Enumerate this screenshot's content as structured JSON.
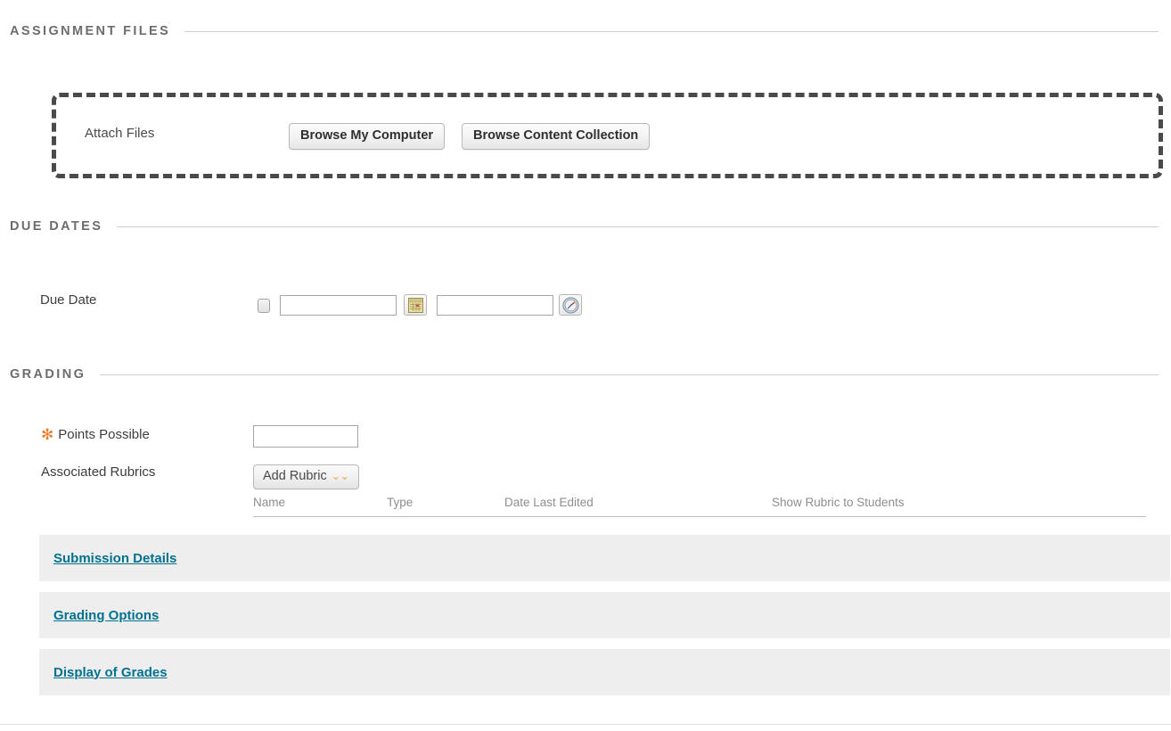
{
  "sections": {
    "assignment_files": {
      "title": "ASSIGNMENT FILES"
    },
    "due_dates": {
      "title": "DUE DATES"
    },
    "grading": {
      "title": "GRADING"
    }
  },
  "attach_files": {
    "label": "Attach Files",
    "browse_computer_label": "Browse My Computer",
    "browse_collection_label": "Browse Content Collection"
  },
  "due_date": {
    "label": "Due Date",
    "checkbox_checked": false,
    "date_value": "",
    "date_placeholder": "",
    "time_value": "",
    "time_placeholder": "",
    "calendar_icon": "calendar-icon",
    "clock_icon": "clock-icon"
  },
  "grading": {
    "points_possible_label": "Points Possible",
    "points_possible_value": "",
    "points_required": true,
    "required_marker": "✻",
    "associated_rubrics_label": "Associated Rubrics",
    "add_rubric_label": "Add Rubric",
    "add_rubric_chevron": "⌄⌄",
    "rubric_table": {
      "headers": [
        "Name",
        "Type",
        "Date Last Edited",
        "Show Rubric to Students"
      ],
      "rows": []
    }
  },
  "collapsible_sections": [
    {
      "label": "Submission Details"
    },
    {
      "label": "Grading Options"
    },
    {
      "label": "Display of Grades"
    }
  ],
  "colors": {
    "link": "#00728f",
    "required": "#f07621",
    "section_heading": "#6d6d6d",
    "bar_background": "#eeeeee"
  }
}
